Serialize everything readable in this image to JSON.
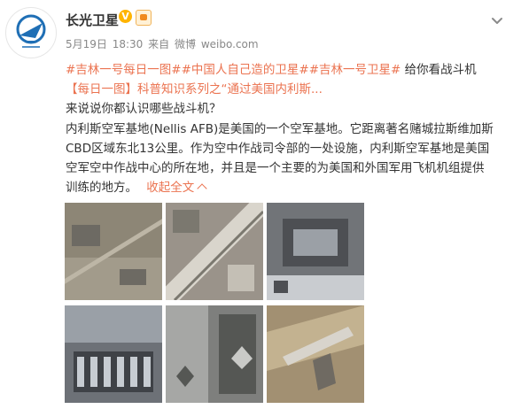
{
  "author": {
    "name": "长光卫星",
    "verified_mark": "V"
  },
  "meta": {
    "date": "5月19日",
    "time": "18:30",
    "source_prefix": "来自",
    "source": "微博",
    "site": "weibo.com"
  },
  "post": {
    "hashtags": [
      "#吉林一号每日一图#",
      "#中国人自己造的卫星#",
      "#吉林一号卫星#"
    ],
    "tail": "给你看战斗机",
    "link_text": "【每日一图】科普知识系列之“通过美国内利斯...",
    "line3": "来说说你都认识哪些战斗机？",
    "line4": "内利斯空军基地(Nellis AFB)是美国的一个空军基地。它距离著名赌城拉斯维加斯",
    "line5": "CBD区域东北13公里。作为空中作战司令部的一处设施，内利斯空军基地是美国",
    "line6": "空军空中作战中心的所在地，并且是一个主要的为美国和外国军用飞机机组提供",
    "line7": "训练的地方。",
    "collapse": "收起全文"
  },
  "images": [
    {
      "name": "satellite-image-1",
      "palette": [
        "#8d8676",
        "#a29b8b",
        "#6d6a63",
        "#bdb6a6"
      ]
    },
    {
      "name": "satellite-image-2",
      "palette": [
        "#9a938a",
        "#c4bfb5",
        "#7b786f",
        "#d9d5cc"
      ]
    },
    {
      "name": "satellite-image-3",
      "palette": [
        "#717478",
        "#9ba0a6",
        "#4d4f53",
        "#c9ccd0"
      ]
    },
    {
      "name": "satellite-image-4",
      "palette": [
        "#6d7177",
        "#9aa0a7",
        "#3f4247",
        "#c7ccd2"
      ]
    },
    {
      "name": "satellite-image-5",
      "palette": [
        "#7e7f7d",
        "#a6a7a5",
        "#555754",
        "#c9cac7"
      ]
    },
    {
      "name": "satellite-image-6",
      "palette": [
        "#a29072",
        "#c3b290",
        "#6f6a62",
        "#d8d4cc"
      ]
    }
  ]
}
